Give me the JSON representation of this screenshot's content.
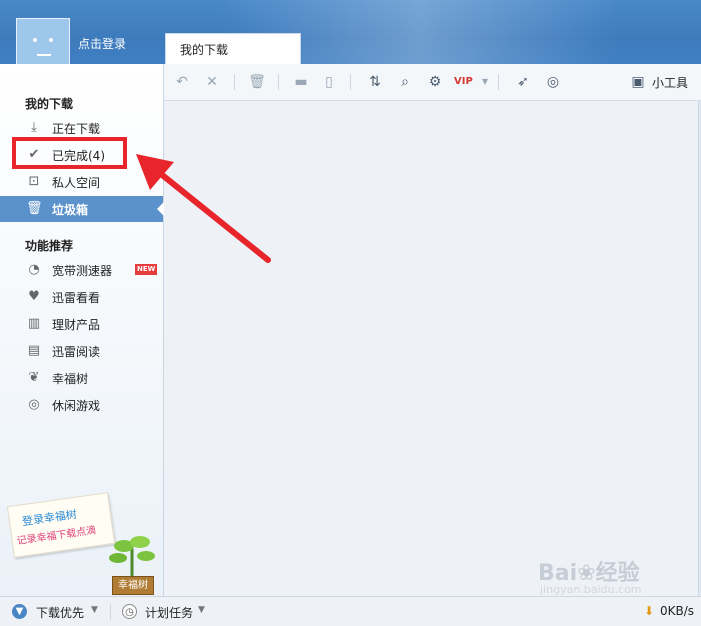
{
  "header": {
    "login_text": "点击登录",
    "tab_label": "我的下载"
  },
  "sidebar": {
    "section_downloads": "我的下载",
    "items": [
      {
        "label": "正在下载",
        "icon": "download-icon"
      },
      {
        "label": "已完成(4)",
        "icon": "check-icon"
      },
      {
        "label": "私人空间",
        "icon": "lock-icon"
      },
      {
        "label": "垃圾箱",
        "icon": "trash-icon",
        "active": true
      }
    ],
    "section_features": "功能推荐",
    "features": [
      {
        "label": "宽带测速器",
        "icon": "speedometer-icon",
        "badge": "NEW"
      },
      {
        "label": "迅雷看看",
        "icon": "heart-icon"
      },
      {
        "label": "理财产品",
        "icon": "coins-icon"
      },
      {
        "label": "迅雷阅读",
        "icon": "book-icon"
      },
      {
        "label": "幸福树",
        "icon": "leaf-icon"
      },
      {
        "label": "休闲游戏",
        "icon": "gamepad-icon"
      }
    ],
    "promo_line1": "登录幸福树",
    "promo_line2": "记录幸福下载点滴",
    "plant_sign": "幸福树"
  },
  "toolbar": {
    "tools_label": "小工具",
    "vip_label": "VIP"
  },
  "statusbar": {
    "priority_label": "下载优先",
    "schedule_label": "计划任务",
    "speed": "0KB/s"
  },
  "watermark": {
    "brand": "Bai",
    "brand_suffix": "经验",
    "url": "jingyan.baidu.com"
  },
  "colors": {
    "title_blue": "#3d7bbd",
    "active_item": "#5b92cb",
    "highlight_red": "#e8252a"
  }
}
